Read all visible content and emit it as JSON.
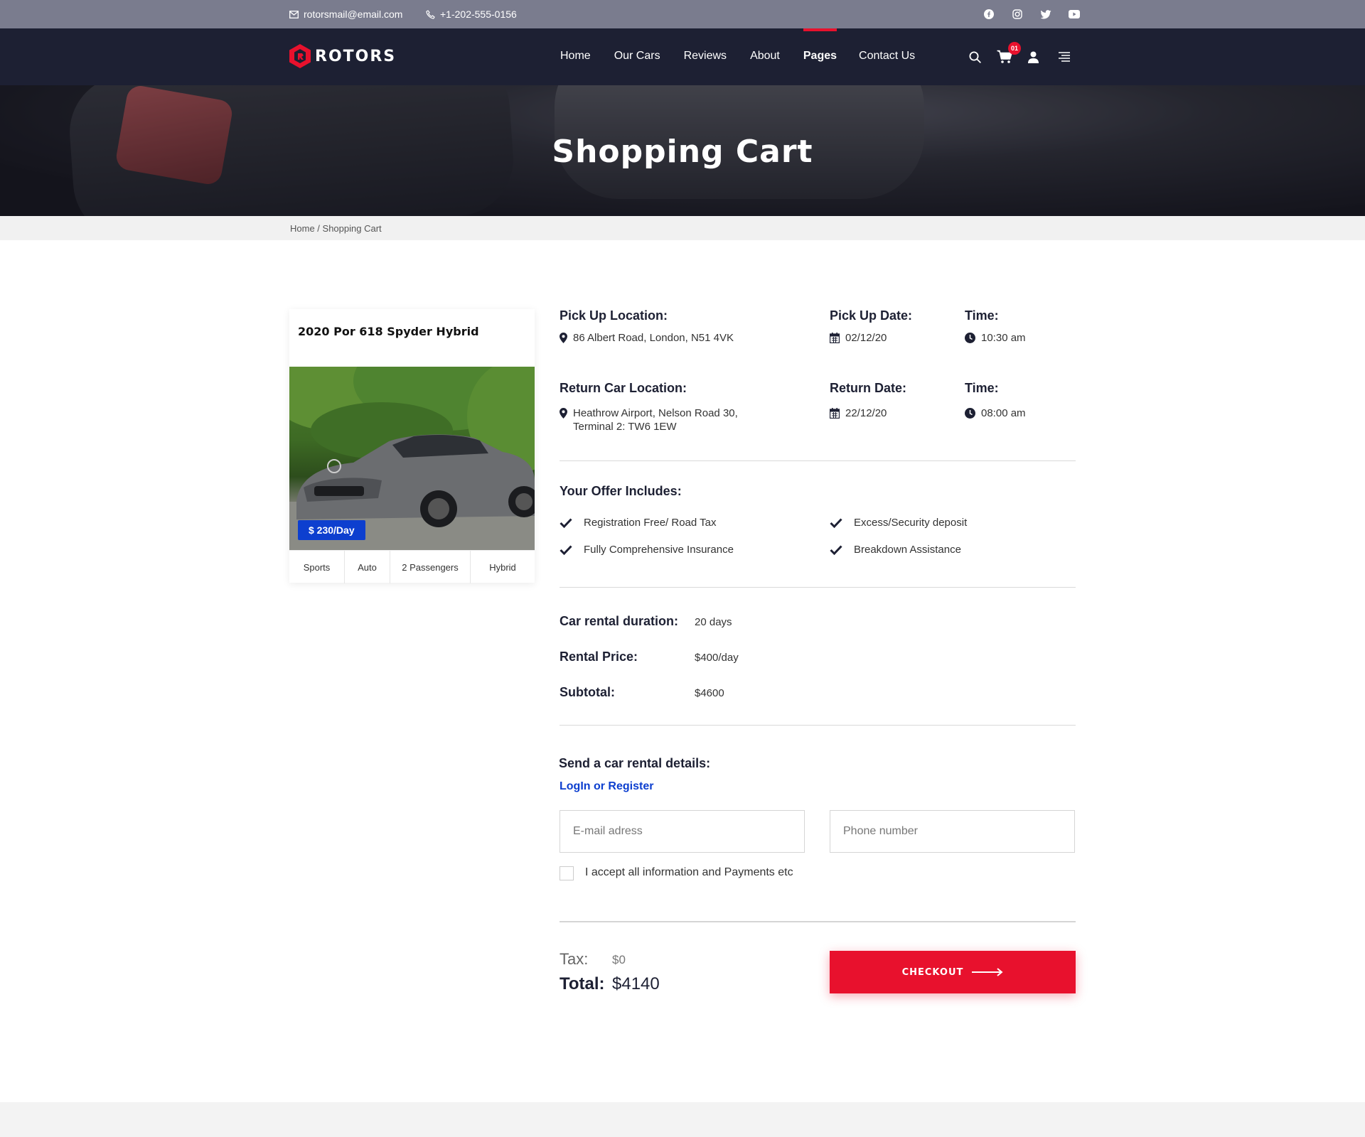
{
  "topbar": {
    "email": "rotorsmail@email.com",
    "phone": "+1-202-555-0156",
    "social_icons": [
      "facebook-icon",
      "instagram-icon",
      "twitter-icon",
      "youtube-icon"
    ]
  },
  "header": {
    "logo_text": "ROTORS",
    "nav": [
      {
        "label": "Home",
        "active": false
      },
      {
        "label": "Our Cars",
        "active": false
      },
      {
        "label": "Reviews",
        "active": false
      },
      {
        "label": "About",
        "active": false
      },
      {
        "label": "Pages",
        "active": true
      },
      {
        "label": "Contact Us",
        "active": false
      }
    ],
    "cart_count": "01",
    "icons": [
      "search-icon",
      "cart-icon",
      "user-icon",
      "menu-icon"
    ]
  },
  "hero": {
    "title": "Shopping Cart"
  },
  "breadcrumb": {
    "home": "Home",
    "separator": " / ",
    "current": "Shopping Cart"
  },
  "car": {
    "title": "2020 Por 618 Spyder Hybrid",
    "price": "$ 230/Day",
    "specs": [
      "Sports",
      "Auto",
      "2 Passengers",
      "Hybrid"
    ]
  },
  "booking": {
    "pickup_location_label": "Pick Up Location:",
    "pickup_location": "86 Albert Road, London, N51 4VK",
    "pickup_date_label": "Pick Up Date:",
    "pickup_date": "02/12/20",
    "pickup_time_label": "Time:",
    "pickup_time": "10:30 am",
    "return_location_label": "Return Car Location:",
    "return_location_line1": "Heathrow Airport, Nelson Road 30,",
    "return_location_line2": "Terminal 2: TW6 1EW",
    "return_date_label": "Return Date:",
    "return_date": "22/12/20",
    "return_time_label": "Time:",
    "return_time": "08:00 am"
  },
  "offer": {
    "title": "Your Offer Includes:",
    "items": [
      "Registration Free/ Road Tax",
      "Excess/Security deposit",
      "Fully Comprehensive Insurance",
      "Breakdown Assistance"
    ]
  },
  "summary": {
    "duration_label": "Car rental duration:",
    "duration": "20 days",
    "price_label": "Rental Price:",
    "price": "$400/day",
    "subtotal_label": "Subtotal:",
    "subtotal": "$4600"
  },
  "send_details": {
    "title": "Send a car rental details:",
    "login_link": "LogIn or Register",
    "email_placeholder": "E-mail adress",
    "phone_placeholder": "Phone number",
    "accept_label": "I accept all information and Payments etc"
  },
  "totals": {
    "tax_label": "Tax:",
    "tax": "$0",
    "total_label": "Total:",
    "total": "$4140",
    "checkout_label": "CHECKOUT"
  },
  "colors": {
    "accent": "#e8112d",
    "primary": "#0d3fcf",
    "header_bg": "#1d2033",
    "topbar_bg": "#7a7c8e"
  }
}
